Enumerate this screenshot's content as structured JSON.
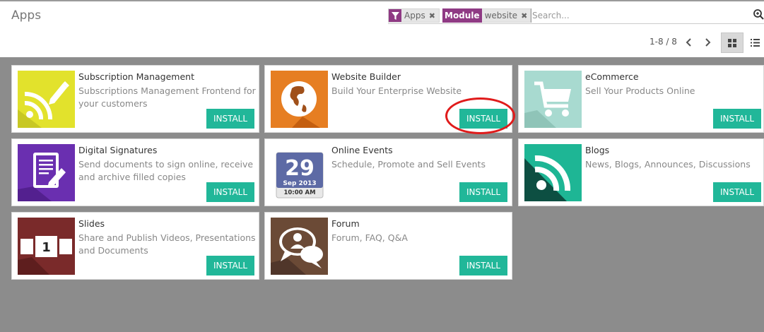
{
  "page": {
    "title": "Apps"
  },
  "search": {
    "facet_apps_label": "Apps",
    "facet_module_category": "Module",
    "facet_module_value": "website",
    "placeholder": "Search..."
  },
  "pager": {
    "value": "1-8 / 8"
  },
  "apps": [
    {
      "title": "Subscription Management",
      "desc": "Subscriptions Management Frontend for your customers",
      "action": "INSTALL",
      "icon": "rss-edit-icon",
      "color": "#e2e22c"
    },
    {
      "title": "Website Builder",
      "desc": "Build Your Enterprise Website",
      "action": "INSTALL",
      "icon": "globe-icon",
      "color": "#e67e22"
    },
    {
      "title": "eCommerce",
      "desc": "Sell Your Products Online",
      "action": "INSTALL",
      "icon": "shopping-cart-icon",
      "color": "#a8dad0"
    },
    {
      "title": "Digital Signatures",
      "desc": "Send documents to sign online, receive and archive filled copies",
      "action": "INSTALL",
      "icon": "document-sign-icon",
      "color": "#6a2fb0"
    },
    {
      "title": "Online Events",
      "desc": "Schedule, Promote and Sell Events",
      "action": "INSTALL",
      "icon": "calendar-icon",
      "color": "#ffffff",
      "calendar": {
        "day": "29",
        "month": "Sep 2013",
        "time": "10:00 AM"
      }
    },
    {
      "title": "Blogs",
      "desc": "News, Blogs, Announces, Discussions",
      "action": "INSTALL",
      "icon": "rss-icon",
      "color": "#1eb695"
    },
    {
      "title": "Slides",
      "desc": "Share and Publish Videos, Presentations and Documents",
      "action": "INSTALL",
      "icon": "slides-icon",
      "color": "#7a2a2a",
      "slide_number": "1"
    },
    {
      "title": "Forum",
      "desc": "Forum, FAQ, Q&A",
      "action": "INSTALL",
      "icon": "forum-chat-icon",
      "color": "#6b4a36"
    }
  ]
}
